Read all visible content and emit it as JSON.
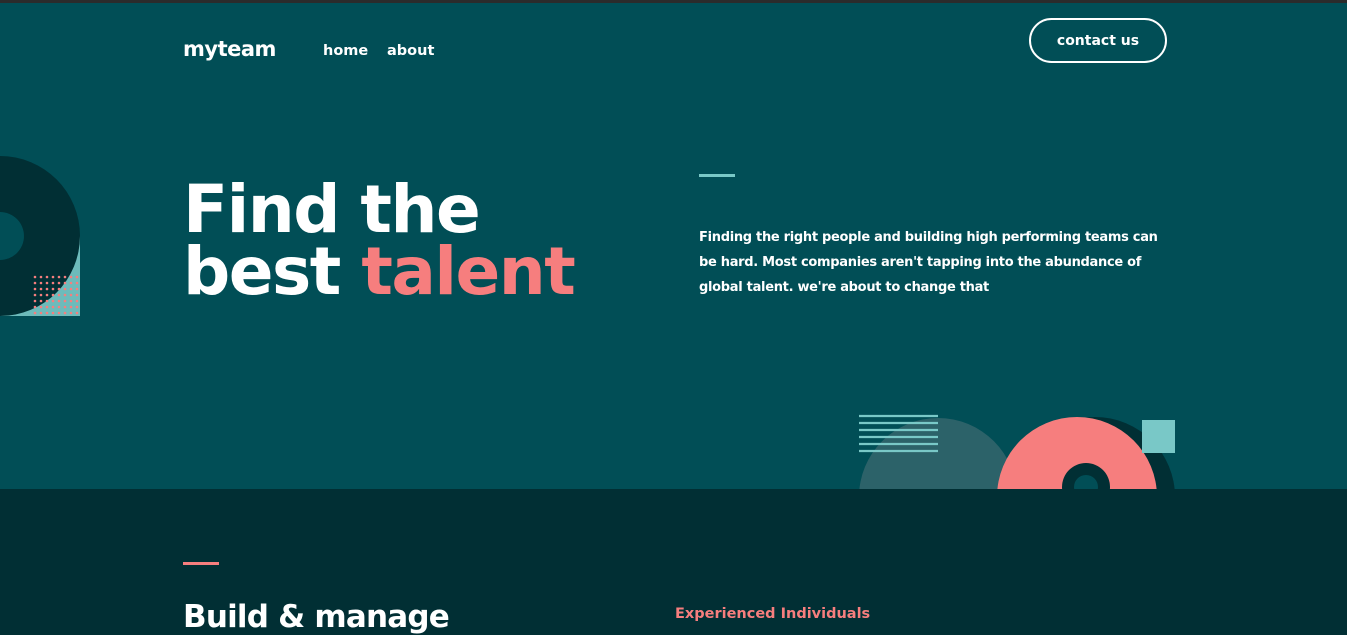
{
  "header": {
    "logo": "myteam",
    "nav": [
      {
        "label": "home"
      },
      {
        "label": "about"
      }
    ],
    "contact_label": "contact us"
  },
  "hero": {
    "title_line1": "Find the",
    "title_line2_plain": "best ",
    "title_line2_accent": "talent",
    "description": "Finding the right people and building high performing teams can be hard. Most companies aren't tapping into the abundance of global talent. we're about to change that"
  },
  "section2": {
    "title": "Build & manage",
    "feature_title": "Experienced Individuals"
  },
  "colors": {
    "dark_teal": "#014e56",
    "deep_teal": "#012f34",
    "coral": "#f67e7e",
    "light_teal": "#79c8c7",
    "white": "#ffffff"
  }
}
